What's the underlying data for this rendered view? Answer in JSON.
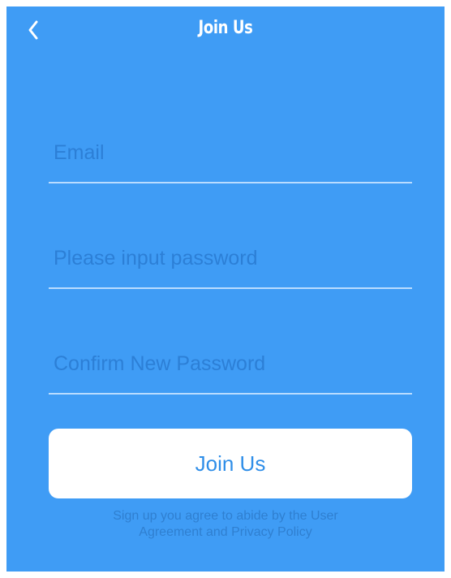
{
  "colors": {
    "background": "#3f9cf5",
    "button_bg": "#ffffff",
    "button_text": "#2f8ee8",
    "placeholder": "#2c7fd6",
    "underline": "#b9dcff"
  },
  "nav": {
    "back_icon": "chevron-left-icon",
    "title": "Join Us"
  },
  "form": {
    "email": {
      "placeholder": "Email",
      "value": ""
    },
    "password": {
      "placeholder": "Please input password",
      "value": ""
    },
    "confirm_password": {
      "placeholder": "Confirm New Password",
      "value": ""
    }
  },
  "join_button": {
    "label": "Join Us"
  },
  "terms": {
    "line1": "Sign up you agree to abide by the User",
    "line2": "Agreement and Privacy Policy"
  }
}
